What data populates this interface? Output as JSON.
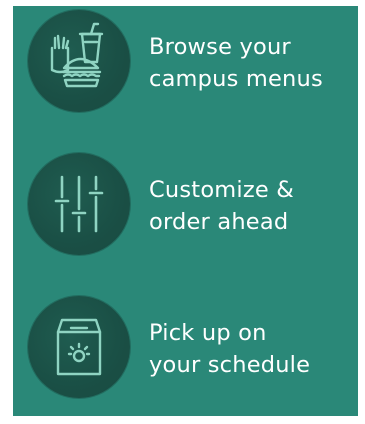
{
  "features": [
    {
      "icon": "food-tray-icon",
      "line1": "Browse your",
      "line2": "campus menus"
    },
    {
      "icon": "sliders-icon",
      "line1": "Customize &",
      "line2": "order ahead"
    },
    {
      "icon": "pickup-bag-icon",
      "line1": "Pick up on",
      "line2": "your schedule"
    }
  ],
  "colors": {
    "panel": "#2a8878",
    "badge": "#1a4f45",
    "icon_stroke": "#8fd4c2",
    "text": "#ffffff"
  }
}
